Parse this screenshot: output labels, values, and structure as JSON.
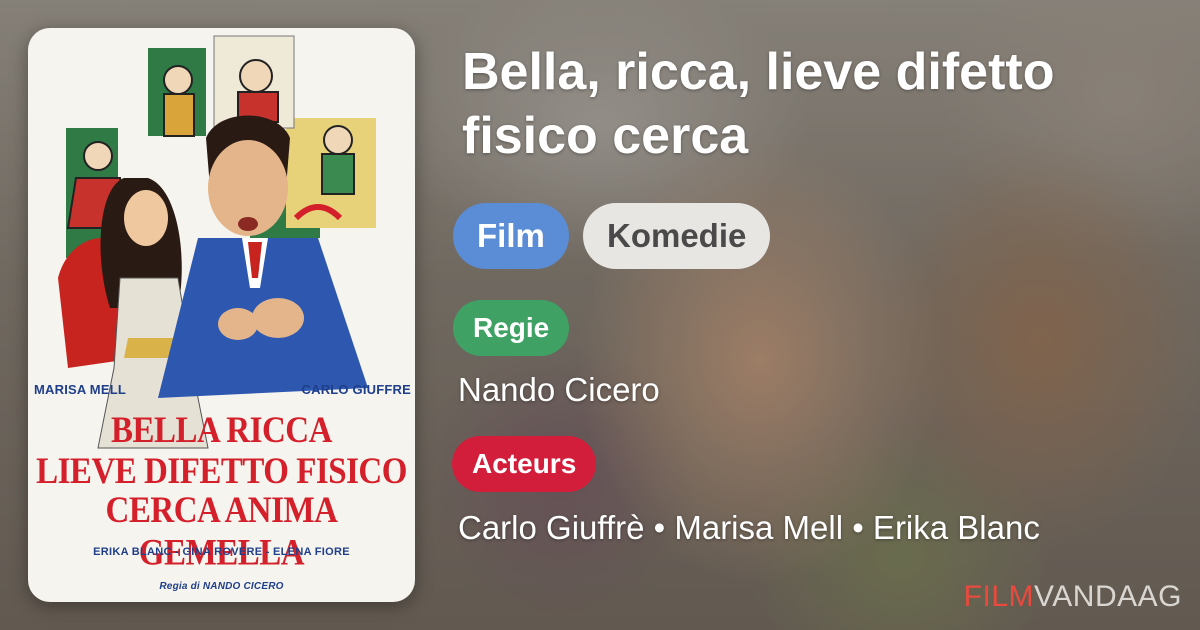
{
  "movie": {
    "title": "Bella, ricca, lieve difetto fisico cerca",
    "type_tag": "Film",
    "genre_tag": "Komedie",
    "director_label": "Regie",
    "director": "Nando Cicero",
    "actors_label": "Acteurs",
    "actors": "Carlo Giuffrè • Marisa Mell • Erika Blanc"
  },
  "poster": {
    "lead_left": "MARISA MELL",
    "lead_right": "CARLO GIUFFRE",
    "title_line1": "BELLA RICCA",
    "title_line2": "LIEVE DIFETTO FISICO",
    "title_line3": "CERCA ANIMA GEMELLA",
    "cast_line": "ERIKA BLANC - GINA ROVERE - ELENA FIORE",
    "direction_line": "Regia di NANDO CICERO"
  },
  "brand": {
    "part1": "FILM",
    "part2": "VANDAAG"
  },
  "colors": {
    "film_tag": "#5b8cd6",
    "genre_tag": "#e8e6e2",
    "regie_label": "#3fa163",
    "acteurs_label": "#d31e3b",
    "brand_accent": "#e84a3e",
    "poster_title_red": "#d4202a",
    "poster_name_blue": "#1f3f8a"
  }
}
